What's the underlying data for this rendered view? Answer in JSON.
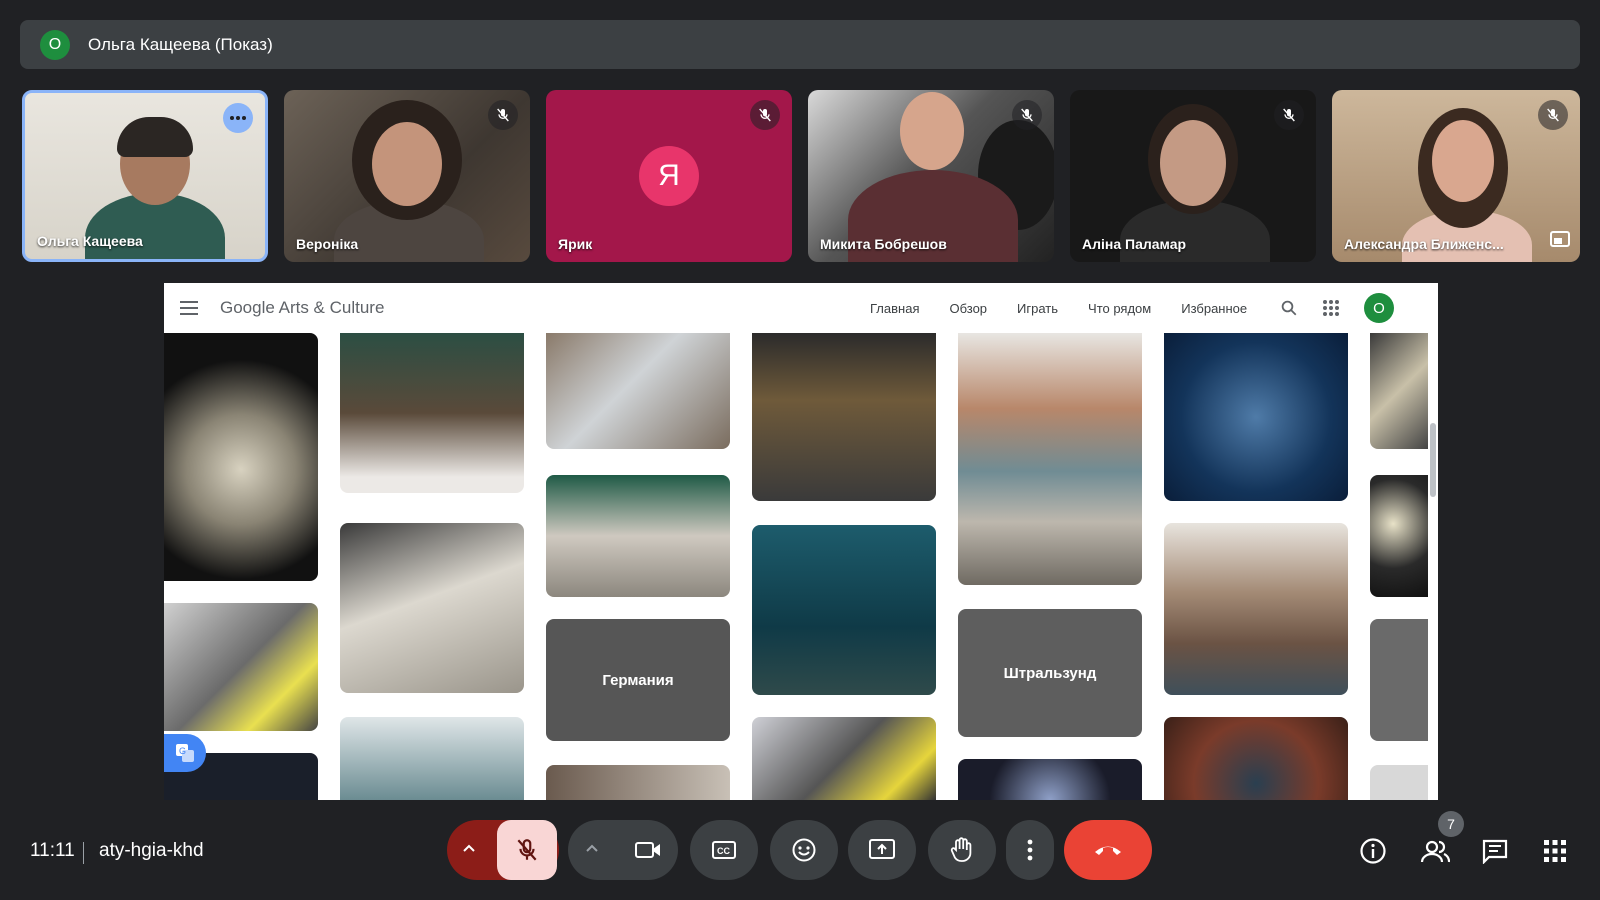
{
  "presenter": {
    "avatar_letter": "O",
    "label": "Ольга Кащеева (Показ)"
  },
  "participants": [
    {
      "name": "Ольга Кащеева",
      "active": true
    },
    {
      "name": "Вероніка",
      "muted": true
    },
    {
      "name": "Ярик",
      "muted": true,
      "avatar_letter": "Я",
      "tile_color": "#a3174a"
    },
    {
      "name": "Микита Бобрешов",
      "muted": true
    },
    {
      "name": "Аліна Паламар",
      "muted": true
    },
    {
      "name": "Александра Ближенс...",
      "muted": true
    }
  ],
  "shared_screen": {
    "site_logo": "Google Arts & Culture",
    "nav": [
      "Главная",
      "Обзор",
      "Играть",
      "Что рядом",
      "Избранное"
    ],
    "account_letter": "O",
    "cards": [
      {
        "label": "Германия"
      },
      {
        "label": "Штральзунд"
      }
    ]
  },
  "bottom_bar": {
    "time": "11:11",
    "meeting_code": "aty-hgia-khd",
    "participants_count": "7",
    "colors": {
      "end_call": "#ea4335",
      "mic_off_bg": "#f9d6d5",
      "mic_group": "#8c1d18"
    }
  },
  "icons": [
    "more-icon",
    "mic-off-icon",
    "pip-icon",
    "hamburger-icon",
    "search-icon",
    "apps-icon",
    "translate-icon",
    "chevron-up-icon",
    "camera-icon",
    "captions-icon",
    "emoji-icon",
    "present-icon",
    "raise-hand-icon",
    "more-vert-icon",
    "end-call-icon",
    "info-icon",
    "people-icon",
    "chat-icon",
    "activities-icon"
  ]
}
